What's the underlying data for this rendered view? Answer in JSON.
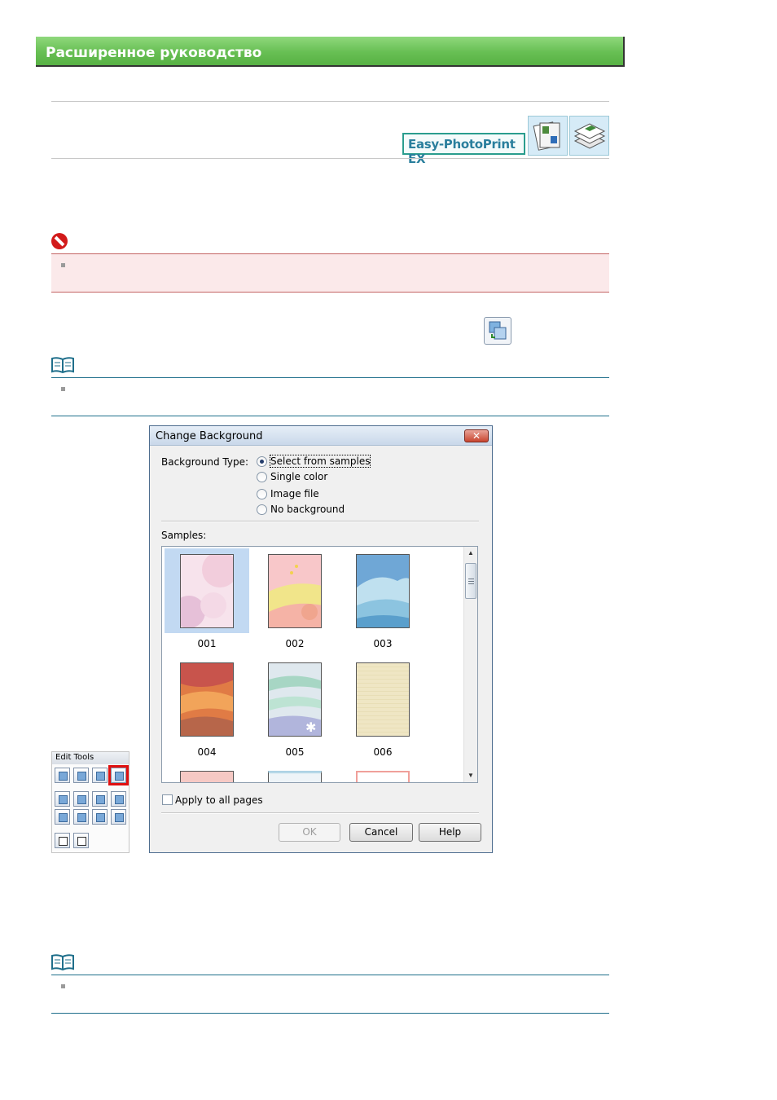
{
  "header": {
    "banner_title": "Расширенное руководство",
    "app_badge": "Easy-PhotoPrint EX",
    "product_icons": [
      "album-icon",
      "layout-print-icon"
    ]
  },
  "inline_icon": "change-background-icon",
  "palette": {
    "title": "Edit Tools",
    "tools_row1": [
      "image-tool-1",
      "image-tool-2",
      "image-tool-3",
      "change-background-tool"
    ],
    "tools_row2": [
      "frame-tool",
      "layout-tool",
      "date-tool",
      "photo-tool"
    ],
    "tools_row3": [
      "image-tool-9",
      "image-tool-10",
      "shape-tool",
      "paint-tool"
    ],
    "tools_row4": [
      "text-tool",
      "vertical-text-tool"
    ],
    "highlighted": "change-background-tool"
  },
  "dialog": {
    "title": "Change Background",
    "close_symbol": "✕",
    "background_type_label": "Background Type:",
    "options": [
      {
        "label": "Select from samples",
        "checked": true
      },
      {
        "label": "Single color",
        "checked": false
      },
      {
        "label": "Image file",
        "checked": false
      },
      {
        "label": "No background",
        "checked": false
      }
    ],
    "samples_label": "Samples:",
    "samples": [
      {
        "label": "001",
        "selected": true
      },
      {
        "label": "002",
        "selected": false
      },
      {
        "label": "003",
        "selected": false
      },
      {
        "label": "004",
        "selected": false
      },
      {
        "label": "005",
        "selected": false
      },
      {
        "label": "006",
        "selected": false
      }
    ],
    "apply_all_label": "Apply to all pages",
    "apply_all_checked": false,
    "buttons": {
      "ok": "OK",
      "cancel": "Cancel",
      "help": "Help"
    },
    "ok_disabled": true
  },
  "colors": {
    "banner_green": "#67bf53",
    "caution_red": "#d21a1a",
    "caution_bg": "#fbe9ea",
    "note_rule": "#1f6f8b",
    "selection_blue": "#c2d9f2"
  }
}
